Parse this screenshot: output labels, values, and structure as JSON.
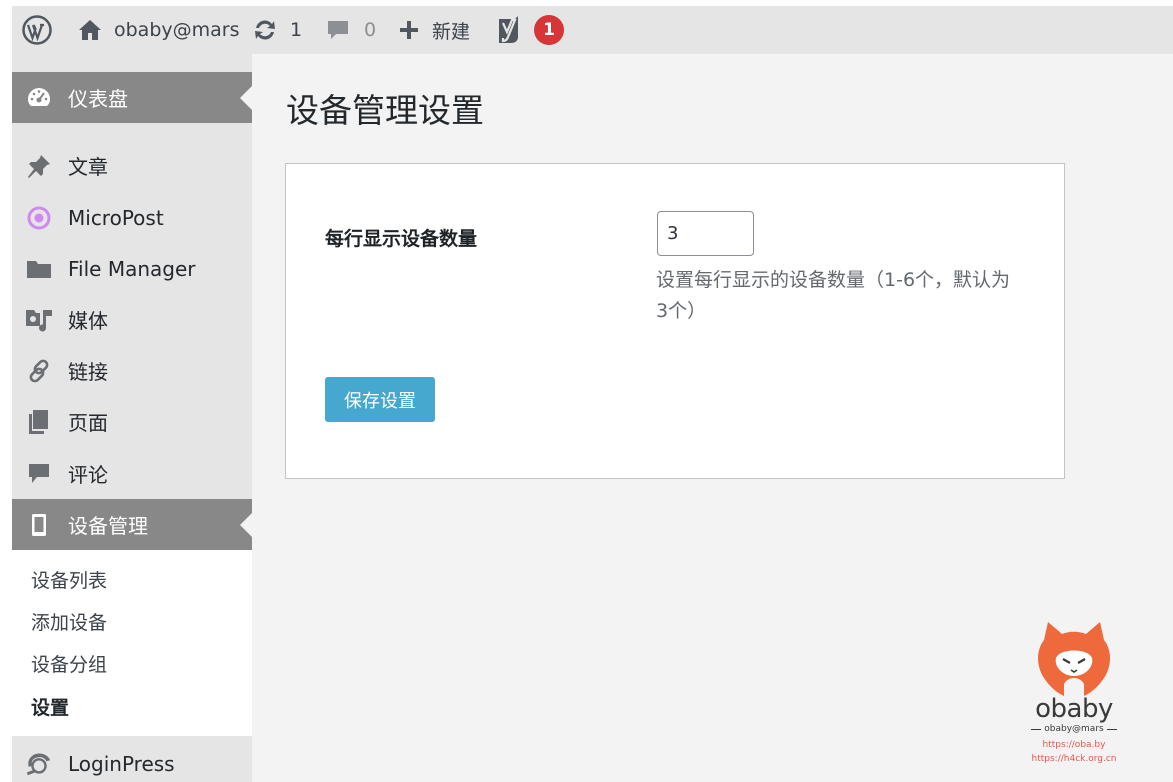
{
  "adminbar": {
    "site_name": "obaby@mars",
    "updates_count": "1",
    "comments_count": "0",
    "new_label": "新建",
    "yoast_badge": "1",
    "icons": [
      "wordpress-logo-icon",
      "home-icon",
      "updates-icon",
      "comment-icon",
      "plus-icon",
      "yoast-icon"
    ]
  },
  "sidebar": {
    "items": [
      {
        "label": "仪表盘",
        "icon": "dashboard-icon",
        "active": true
      },
      {
        "label": "文章",
        "icon": "pin-icon"
      },
      {
        "label": "MicroPost",
        "icon": "micropost-icon"
      },
      {
        "label": "File Manager",
        "icon": "folder-icon"
      },
      {
        "label": "媒体",
        "icon": "media-icon"
      },
      {
        "label": "链接",
        "icon": "link-icon"
      },
      {
        "label": "页面",
        "icon": "page-icon"
      },
      {
        "label": "评论",
        "icon": "comment-icon"
      },
      {
        "label": "设备管理",
        "icon": "device-icon",
        "active": true,
        "current": true
      },
      {
        "label": "LoginPress",
        "icon": "loginpress-icon"
      }
    ],
    "submenu": [
      {
        "label": "设备列表"
      },
      {
        "label": "添加设备"
      },
      {
        "label": "设备分组"
      },
      {
        "label": "设置",
        "current": true
      }
    ]
  },
  "main": {
    "title": "设备管理设置",
    "field_label": "每行显示设备数量",
    "field_value": "3",
    "field_desc": "设置每行显示的设备数量（1-6个，默认为3个）",
    "save_label": "保存设置"
  },
  "watermark": {
    "brand": "obaby",
    "sub": "obaby@mars",
    "url1": "https://oba.by",
    "url2": "https://h4ck.org.cn"
  },
  "colors": {
    "accent": "#46a7cf",
    "active_menu": "#888888",
    "badge": "#d63638",
    "watermark_orange": "#e8564d"
  }
}
